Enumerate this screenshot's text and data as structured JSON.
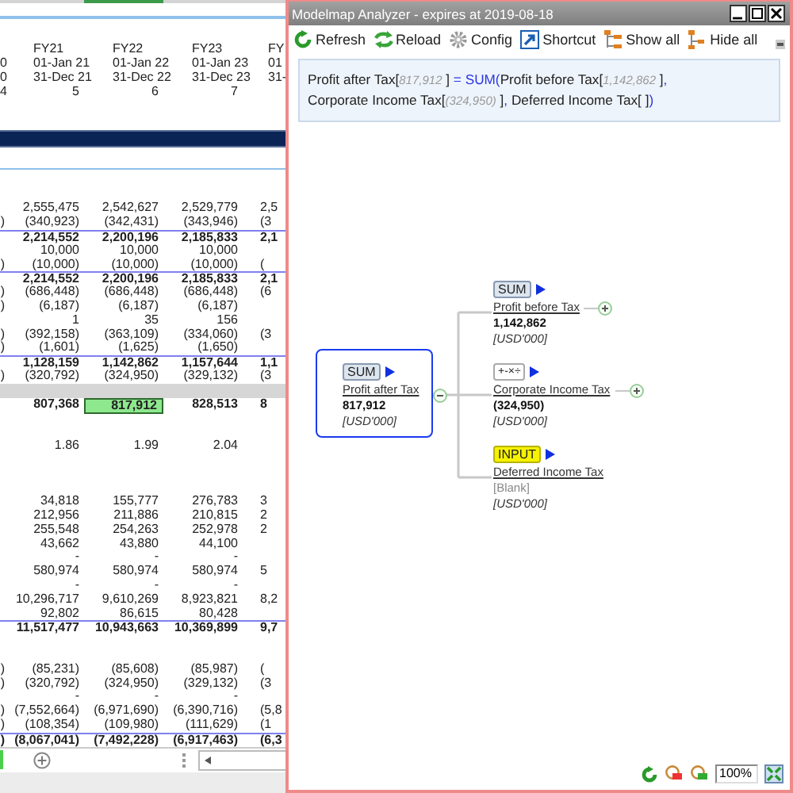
{
  "spreadsheet": {
    "header_rows": [
      [
        null,
        "FY21",
        "FY22",
        "FY23",
        "FY"
      ],
      [
        "0",
        "01-Jan 21",
        "01-Jan 22",
        "01-Jan 23",
        "01"
      ],
      [
        "0",
        "31-Dec 21",
        "31-Dec 22",
        "31-Dec 23",
        "31-"
      ],
      [
        "4",
        "5",
        "6",
        "7",
        null
      ]
    ],
    "rows": [
      {
        "kind": "value",
        "cells": [
          null,
          "2,555,475",
          "2,542,627",
          "2,529,779",
          "2,5"
        ]
      },
      {
        "kind": "value",
        "cells": [
          ")",
          "(340,923)",
          "(342,431)",
          "(343,946)",
          "(3"
        ]
      },
      {
        "kind": "total",
        "cells": [
          null,
          "2,214,552",
          "2,200,196",
          "2,185,833",
          "2,1"
        ]
      },
      {
        "kind": "value",
        "cells": [
          null,
          "10,000",
          "10,000",
          "10,000",
          null
        ]
      },
      {
        "kind": "value",
        "cells": [
          ")",
          "(10,000)",
          "(10,000)",
          "(10,000)",
          "("
        ]
      },
      {
        "kind": "total",
        "cells": [
          null,
          "2,214,552",
          "2,200,196",
          "2,185,833",
          "2,1"
        ]
      },
      {
        "kind": "value",
        "cells": [
          ")",
          "(686,448)",
          "(686,448)",
          "(686,448)",
          "(6"
        ]
      },
      {
        "kind": "value",
        "cells": [
          ")",
          "(6,187)",
          "(6,187)",
          "(6,187)",
          null
        ]
      },
      {
        "kind": "value",
        "cells": [
          null,
          "1",
          "35",
          "156",
          null
        ]
      },
      {
        "kind": "value",
        "cells": [
          ")",
          "(392,158)",
          "(363,109)",
          "(334,060)",
          "(3"
        ]
      },
      {
        "kind": "value",
        "cells": [
          ")",
          "(1,601)",
          "(1,625)",
          "(1,650)",
          null
        ]
      },
      {
        "kind": "total",
        "cells": [
          null,
          "1,128,159",
          "1,142,862",
          "1,157,644",
          "1,1"
        ]
      },
      {
        "kind": "value",
        "cells": [
          ")",
          "(320,792)",
          "(324,950)",
          "(329,132)",
          "(3"
        ]
      },
      {
        "kind": "band",
        "cells": []
      },
      {
        "kind": "result",
        "cells": [
          null,
          {
            "text": "807,368",
            "selected": false
          },
          {
            "text": "817,912",
            "selected": true
          },
          {
            "text": "828,513",
            "selected": false
          },
          {
            "text": "8",
            "selected": false
          }
        ]
      },
      {
        "kind": "spacer",
        "cells": []
      },
      {
        "kind": "spacer",
        "cells": []
      },
      {
        "kind": "value",
        "cells": [
          null,
          "1.86",
          "1.99",
          "2.04",
          null
        ]
      },
      {
        "kind": "spacer",
        "cells": []
      },
      {
        "kind": "spacer",
        "cells": []
      },
      {
        "kind": "spacer",
        "cells": []
      },
      {
        "kind": "value",
        "cells": [
          null,
          "34,818",
          "155,777",
          "276,783",
          "3"
        ]
      },
      {
        "kind": "value",
        "cells": [
          null,
          "212,956",
          "211,886",
          "210,815",
          "2"
        ]
      },
      {
        "kind": "value",
        "cells": [
          null,
          "255,548",
          "254,263",
          "252,978",
          "2"
        ]
      },
      {
        "kind": "value",
        "cells": [
          null,
          "43,662",
          "43,880",
          "44,100",
          null
        ]
      },
      {
        "kind": "value",
        "cells": [
          null,
          "-",
          "-",
          "-",
          null
        ]
      },
      {
        "kind": "value",
        "cells": [
          null,
          "580,974",
          "580,974",
          "580,974",
          "5"
        ]
      },
      {
        "kind": "value",
        "cells": [
          null,
          "-",
          "-",
          "-",
          null
        ]
      },
      {
        "kind": "value",
        "cells": [
          null,
          "10,296,717",
          "9,610,269",
          "8,923,821",
          "8,2"
        ]
      },
      {
        "kind": "value",
        "cells": [
          null,
          "92,802",
          "86,615",
          "80,428",
          null
        ]
      },
      {
        "kind": "total",
        "cells": [
          null,
          "11,517,477",
          "10,943,663",
          "10,369,899",
          "9,7"
        ]
      },
      {
        "kind": "spacer",
        "cells": []
      },
      {
        "kind": "spacer",
        "cells": []
      },
      {
        "kind": "value",
        "cells": [
          ")",
          "(85,231)",
          "(85,608)",
          "(85,987)",
          "("
        ]
      },
      {
        "kind": "value",
        "cells": [
          ")",
          "(320,792)",
          "(324,950)",
          "(329,132)",
          "(3"
        ]
      },
      {
        "kind": "value",
        "cells": [
          null,
          "-",
          "-",
          "-",
          null
        ]
      },
      {
        "kind": "value",
        "cells": [
          ")",
          "(7,552,664)",
          "(6,971,690)",
          "(6,390,716)",
          "(5,8"
        ]
      },
      {
        "kind": "value",
        "cells": [
          ")",
          "(108,354)",
          "(109,980)",
          "(111,629)",
          "(1"
        ]
      },
      {
        "kind": "total",
        "cells": [
          ")",
          "(8,067,041)",
          "(7,492,228)",
          "(6,917,463)",
          "(6,3"
        ]
      }
    ]
  },
  "window": {
    "title": "Modelmap Analyzer - expires at 2019-08-18"
  },
  "toolbar": [
    {
      "label": "Refresh"
    },
    {
      "label": "Reload"
    },
    {
      "label": "Config"
    },
    {
      "label": "Shortcut"
    },
    {
      "label": "Show all"
    },
    {
      "label": "Hide all"
    }
  ],
  "formula": {
    "lines": [
      [
        {
          "kind": "text",
          "text": "Profit after Tax["
        },
        {
          "kind": "value",
          "text": "817,912"
        },
        {
          "kind": "text",
          "text": " ]"
        },
        {
          "kind": "op",
          "text": " = SUM("
        },
        {
          "kind": "text",
          "text": "Profit before Tax["
        },
        {
          "kind": "value",
          "text": "1,142,862"
        },
        {
          "kind": "text",
          "text": " ]"
        },
        {
          "kind": "op",
          "text": ","
        }
      ],
      [
        {
          "kind": "text",
          "text": "Corporate Income Tax["
        },
        {
          "kind": "value",
          "text": "(324,950)"
        },
        {
          "kind": "text",
          "text": " ]"
        },
        {
          "kind": "op",
          "text": ", "
        },
        {
          "kind": "text",
          "text": "Deferred Income Tax[ ]"
        },
        {
          "kind": "op",
          "text": ")"
        }
      ]
    ]
  },
  "map": {
    "root": {
      "tag": "SUM",
      "kind": "sum",
      "name": "Profit after Tax",
      "value": "817,912",
      "unit": "[USD'000]",
      "selected": true
    },
    "children": [
      {
        "tag": "SUM",
        "kind": "sum",
        "name": "Profit before Tax",
        "value": "1,142,862",
        "blank": false,
        "unit": "[USD'000]",
        "expandable": true
      },
      {
        "tag": "+-×÷",
        "kind": "arith",
        "name": "Corporate Income Tax",
        "value": "(324,950)",
        "blank": false,
        "unit": "[USD'000]",
        "expandable": true
      },
      {
        "tag": "INPUT",
        "kind": "input",
        "name": "Deferred Income Tax",
        "value": "[Blank]",
        "blank": true,
        "unit": "[USD'000]",
        "expandable": false
      }
    ]
  },
  "zoom": "100%"
}
